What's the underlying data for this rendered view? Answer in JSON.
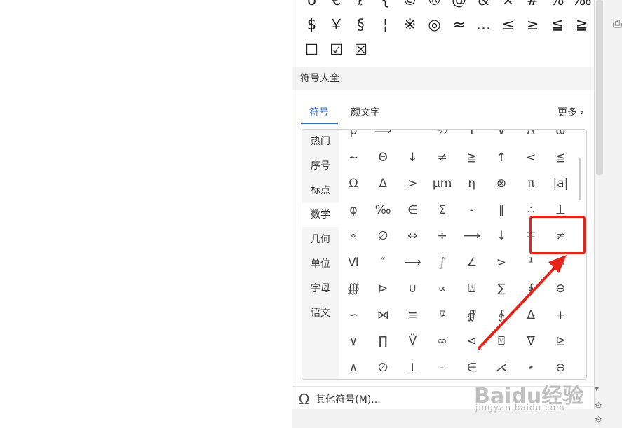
{
  "quick_symbols": {
    "row0": [
      "ö",
      "€",
      "ℓ",
      "{",
      "©",
      "®",
      "@",
      "&",
      "×",
      "#",
      "%",
      "‰"
    ],
    "row1": [
      "$",
      "￥",
      "§",
      "¦",
      "※",
      "◎",
      "≈",
      "…",
      "≤",
      "≥",
      "≦",
      "≧"
    ],
    "row2": [
      "☐",
      "☑",
      "☒"
    ]
  },
  "section_title": "符号大全",
  "tabs": [
    "符号",
    "颜文字"
  ],
  "more_label": "更多",
  "more_icon": "chevron-right-icon",
  "categories": [
    "热门",
    "序号",
    "标点",
    "数学",
    "几何",
    "单位",
    "字母",
    "语文"
  ],
  "active_category": "数学",
  "symbol_rows": [
    [
      "ρ",
      "⟹",
      "",
      "½",
      "Τ",
      "∨",
      "Λ",
      "ω"
    ],
    [
      "~",
      "Θ",
      "↓",
      "≠",
      "≧",
      "↑",
      "<",
      "≦"
    ],
    [
      "Ω",
      "Δ",
      ">",
      "μm",
      "η",
      "⊗",
      "π",
      "|a|"
    ],
    [
      "φ",
      "‰",
      "∈",
      "Σ",
      "-",
      "∥",
      "∴",
      "⊥"
    ],
    [
      "∘",
      "∅",
      "⇔",
      "÷",
      "⟶",
      "↓",
      "∓",
      "≠"
    ],
    [
      "Ⅵ",
      "″",
      "⟶",
      "∫",
      "∠",
      ">",
      "¹",
      "∗"
    ],
    [
      "∰",
      "⊳",
      "∪",
      "∝",
      "⍍",
      "∑",
      "∮",
      "⊖"
    ],
    [
      "∽",
      "⋈",
      "≡",
      "⍫",
      "∯",
      "∲",
      "Δ",
      "+"
    ],
    [
      "∨",
      "∏",
      "V̈",
      "∞",
      "⊲",
      "⍔",
      "∇",
      "⊵"
    ],
    [
      "∧",
      "∅",
      "⊥",
      "-",
      "∈",
      "⋌",
      "⋆",
      "⊖"
    ]
  ],
  "footer": {
    "icon": "omega-icon",
    "label": "其他符号(M)..."
  },
  "side_icon": "print-icon",
  "watermark": {
    "main": "Baidu经验",
    "sub": "jingyan.baidu.com"
  },
  "colors": {
    "accent": "#2f6fd6",
    "highlight": "#e8241a"
  }
}
